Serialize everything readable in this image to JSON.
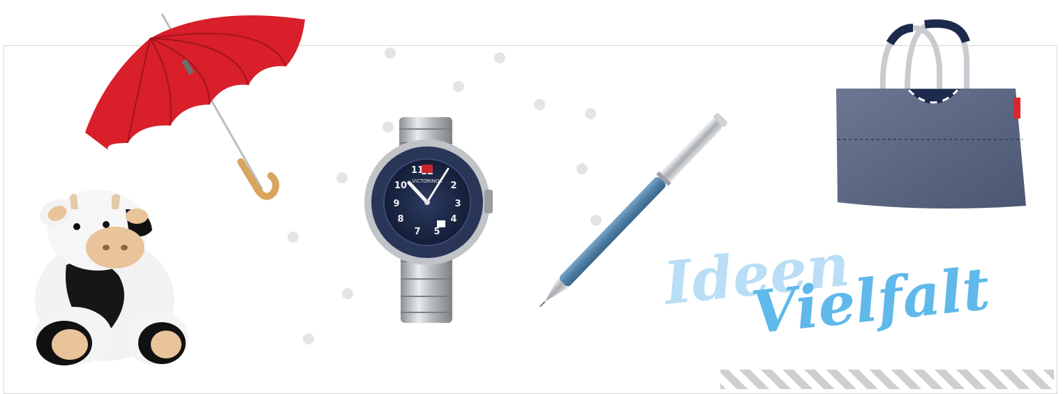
{
  "banner": {
    "tagline_line1": "Ideen",
    "tagline_line2": "Vielfalt",
    "watch_brand_text": "VICTORINOX"
  },
  "products": [
    {
      "icon": "umbrella-icon",
      "color": "#d81f2a"
    },
    {
      "icon": "plush-cow-icon",
      "color": "#f2f2f2"
    },
    {
      "icon": "wristwatch-icon",
      "color": "#1d2a4d"
    },
    {
      "icon": "pen-icon",
      "color": "#4f7fa6"
    },
    {
      "icon": "tote-bag-icon",
      "color": "#55627f"
    }
  ],
  "colors": {
    "accent_light": "#b9def5",
    "accent_dark": "#1593dc",
    "dots": "#e4e4e4",
    "frame_border": "#d6d6d6",
    "stripes": "#cfcfcf"
  }
}
